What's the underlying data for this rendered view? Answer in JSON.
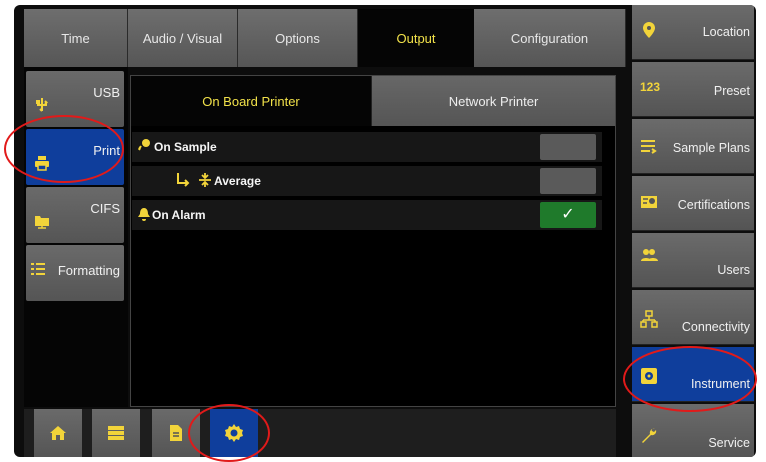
{
  "top_tabs": [
    {
      "label": "Time"
    },
    {
      "label": "Audio / Visual"
    },
    {
      "label": "Options"
    },
    {
      "label": "Output"
    },
    {
      "label": "Configuration"
    }
  ],
  "left_menu": [
    {
      "label": "USB",
      "icon": "usb-icon"
    },
    {
      "label": "Print",
      "icon": "printer-icon"
    },
    {
      "label": "CIFS",
      "icon": "network-folder-icon"
    },
    {
      "label": "Formatting",
      "icon": "list-format-icon"
    }
  ],
  "subtabs": {
    "active": "On Board Printer",
    "other": "Network Printer"
  },
  "rows": [
    {
      "label": "On Sample",
      "checked": false
    },
    {
      "label": "Average",
      "checked": false
    },
    {
      "label": "On Alarm",
      "checked": true,
      "check": "✓"
    }
  ],
  "right_menu": [
    {
      "label": "Location",
      "icon": "location-pin-icon"
    },
    {
      "label": "Preset",
      "icon": "123"
    },
    {
      "label": "Sample Plans",
      "icon": "sample-plans-icon"
    },
    {
      "label": "Certifications",
      "icon": "certificate-icon"
    },
    {
      "label": "Users",
      "icon": "users-icon"
    },
    {
      "label": "Connectivity",
      "icon": "network-icon"
    },
    {
      "label": "Instrument",
      "icon": "instrument-icon"
    },
    {
      "label": "Service",
      "icon": "wrench-icon"
    }
  ],
  "bottom_bar": [
    "home-icon",
    "list-icon",
    "document-icon",
    "settings-gear-icon"
  ],
  "colors": {
    "accent": "#f2e24a",
    "selected": "#0f3e9c",
    "check_on": "#1f7a2b",
    "annotation": "#e11a1a"
  }
}
